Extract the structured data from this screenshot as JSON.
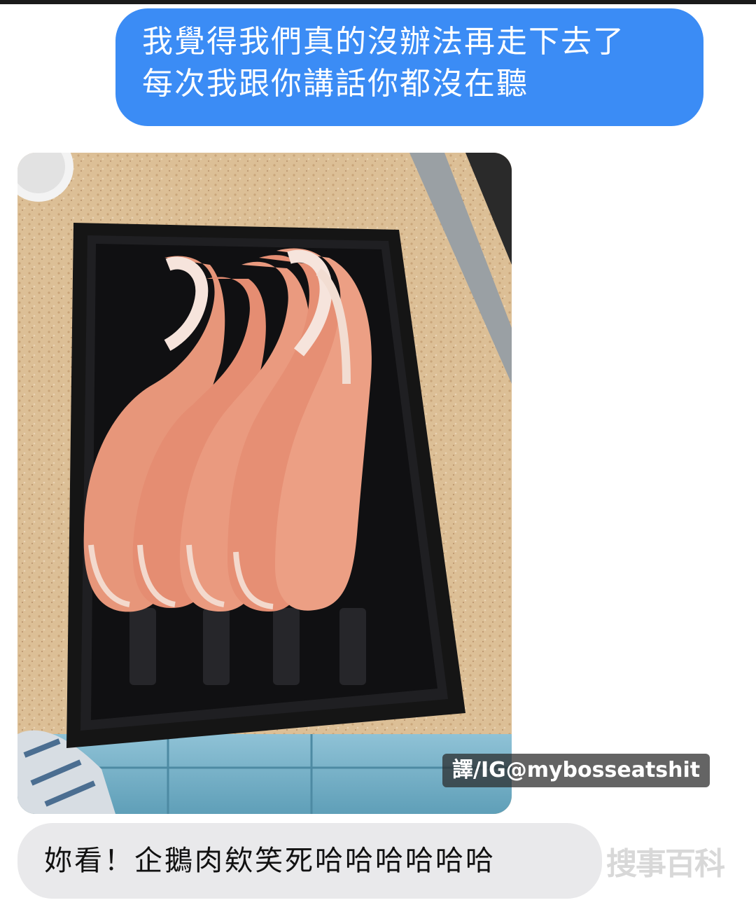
{
  "messages": {
    "outgoing": {
      "line1": "我覺得我們真的沒辦法再走下去了",
      "line2": "每次我跟你講話你都沒在聽"
    },
    "photo": {
      "caption_tag": "譯/IG@mybosseatshit"
    },
    "incoming": {
      "text": "妳看！企鵝肉欸笑死哈哈哈哈哈哈"
    }
  },
  "source_logo": "搜事百科",
  "colors": {
    "outgoing_bubble": "#3b8cf5",
    "incoming_bubble": "#e9e9eb",
    "background": "#ffffff"
  }
}
